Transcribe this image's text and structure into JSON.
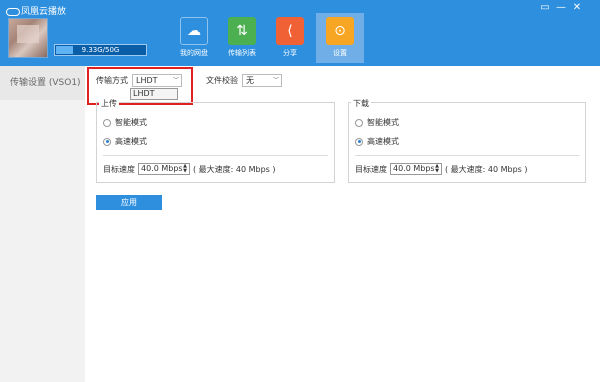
{
  "app": {
    "title": "凤凰云播放"
  },
  "window_controls": [
    "▭",
    "—",
    "✕"
  ],
  "user": {
    "storage_text": "9.33G/50G",
    "storage_used_fraction": 0.187
  },
  "nav": [
    {
      "label": "我的网盘",
      "icon": "cloud-icon",
      "color": "#2d8fde",
      "symbol": "☁"
    },
    {
      "label": "传输列表",
      "icon": "transfer-icon",
      "color": "#4cb050",
      "symbol": "⇅"
    },
    {
      "label": "分享",
      "icon": "share-icon",
      "color": "#f06236",
      "symbol": "⟨"
    },
    {
      "label": "设置",
      "icon": "settings-icon",
      "color": "#f6a623",
      "symbol": "⊙",
      "active": true
    }
  ],
  "sidebar": {
    "item": "传输设置 (VSO1)"
  },
  "settings": {
    "transfer_mode_label": "传输方式",
    "transfer_mode_value": "LHDT",
    "transfer_mode_options": [
      "LHDT"
    ],
    "file_check_label": "文件校验",
    "file_check_value": "无"
  },
  "upload": {
    "title": "上传",
    "smart_label": "智能模式",
    "fast_label": "高速模式",
    "selected": "fast",
    "speed_label": "目标速度",
    "speed_value": "40.0 Mbps",
    "max_speed_text": "( 最大速度: 40 Mbps )"
  },
  "download": {
    "title": "下载",
    "smart_label": "智能模式",
    "fast_label": "高速模式",
    "selected": "fast",
    "speed_label": "目标速度",
    "speed_value": "40.0 Mbps",
    "max_speed_text": "( 最大速度: 40 Mbps )"
  },
  "apply_label": "应用",
  "colors": {
    "header": "#2d8fde",
    "highlight": "#e02020",
    "button": "#2d8fde"
  }
}
